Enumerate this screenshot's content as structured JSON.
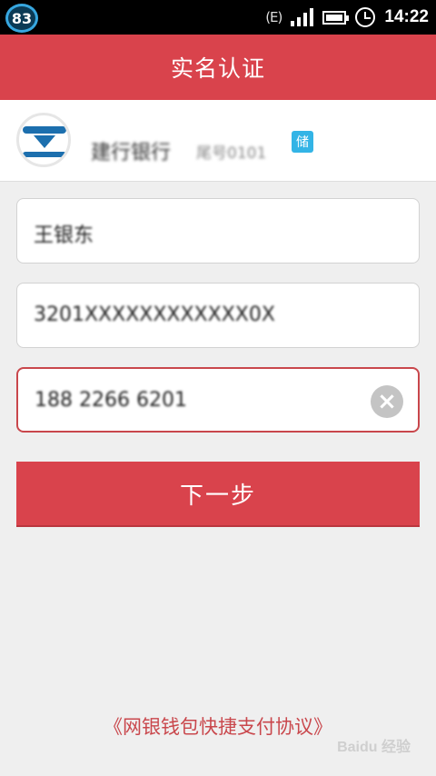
{
  "status_bar": {
    "badge": "83",
    "network": "(E)",
    "time": "14:22"
  },
  "header": {
    "title": "实名认证"
  },
  "bank_card": {
    "bank_name": "建行银行",
    "tail_label": "尾号0101",
    "card_type": "储"
  },
  "form": {
    "name_value": "王银东",
    "id_value": "3201XXXXXXXXXXXX0X",
    "phone_value": "188 2266 6201"
  },
  "actions": {
    "next_label": "下一步"
  },
  "footer": {
    "agreement_link": "《网银钱包快捷支付协议》",
    "watermark": "Baidu 经验"
  },
  "colors": {
    "accent": "#d9434c",
    "card_badge": "#33b4e6"
  }
}
